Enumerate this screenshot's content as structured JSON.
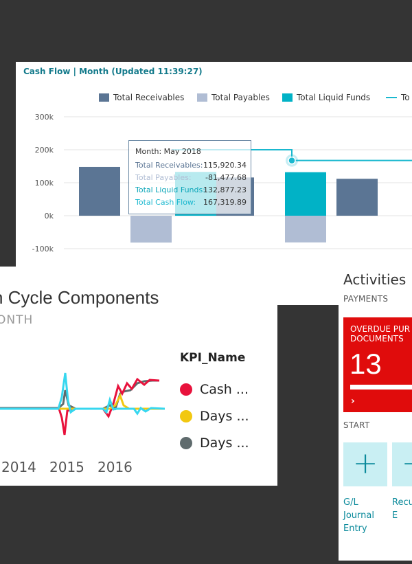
{
  "cash_flow": {
    "title": "Cash Flow | Month (Updated 11:39:27)",
    "legend": [
      {
        "label": "Total Receivables",
        "color": "#5b7594"
      },
      {
        "label": "Total Payables",
        "color": "#b0bdd4"
      },
      {
        "label": "Total Liquid Funds",
        "color": "#01b2c6"
      },
      {
        "label": "To",
        "color": "#1ab8cf"
      }
    ],
    "chart_data": {
      "type": "bar",
      "categories": [
        "",
        "",
        "",
        "",
        "",
        ""
      ],
      "series": [
        {
          "name": "Total Receivables",
          "values": [
            148000,
            null,
            115920.34,
            null,
            null,
            112000
          ],
          "color": "#5b7594"
        },
        {
          "name": "Total Payables",
          "values": [
            null,
            -81477.68,
            null,
            null,
            -81000,
            null
          ],
          "color": "#b0bdd4"
        },
        {
          "name": "Total Liquid Funds",
          "values": [
            null,
            null,
            132877.23,
            null,
            132000,
            null
          ],
          "color": "#01b2c6"
        },
        {
          "name": "To",
          "type": "line",
          "values": [
            null,
            200000,
            200000,
            167319.89,
            167319.89,
            167319.89
          ],
          "color": "#1ab8cf"
        }
      ],
      "yticks": [
        "300k",
        "200k",
        "100k",
        "0k",
        "-100k"
      ],
      "ylim": [
        -100000,
        300000
      ],
      "grid": true
    },
    "tooltip": {
      "month": "Month: May 2018",
      "rows": [
        {
          "label": "Total Receivables:",
          "value": "115,920.34",
          "color": "#5b7594"
        },
        {
          "label": "Total Payables:",
          "value": "-81,477.68",
          "color": "#b0bdd4"
        },
        {
          "label": "Total Liquid Funds:",
          "value": "132,877.23",
          "color": "#0aa5b8"
        },
        {
          "label": "Total Cash Flow:",
          "value": "167,319.89",
          "color": "#1ab8cf"
        }
      ]
    }
  },
  "cycle": {
    "title": "h Cycle Components",
    "subtitle": "ONTH",
    "legend_title": "KPI_Name",
    "legend": [
      {
        "label": "Cash ...",
        "color": "#e8123c"
      },
      {
        "label": "Days ...",
        "color": "#f2c811"
      },
      {
        "label": "Days ...",
        "color": "#5f6b6d"
      }
    ],
    "years": [
      "2014",
      "2015",
      "2016"
    ],
    "line_colors": {
      "cash": "#e8123c",
      "days1": "#f2c811",
      "days2": "#5f6b6d",
      "days3": "#37d7ef"
    }
  },
  "activities": {
    "title": "Activities",
    "payments_caption": "PAYMENTS",
    "overdue_label": "OVERDUE PUR DOCUMENTS",
    "overdue_count": "13",
    "overdue_arrow": "›",
    "start_caption": "START",
    "start_tiles": [
      {
        "icon": "plus-icon",
        "label": "G/L Journal Entry"
      },
      {
        "icon": "plus-icon",
        "label": "Recu G/L E"
      }
    ]
  }
}
